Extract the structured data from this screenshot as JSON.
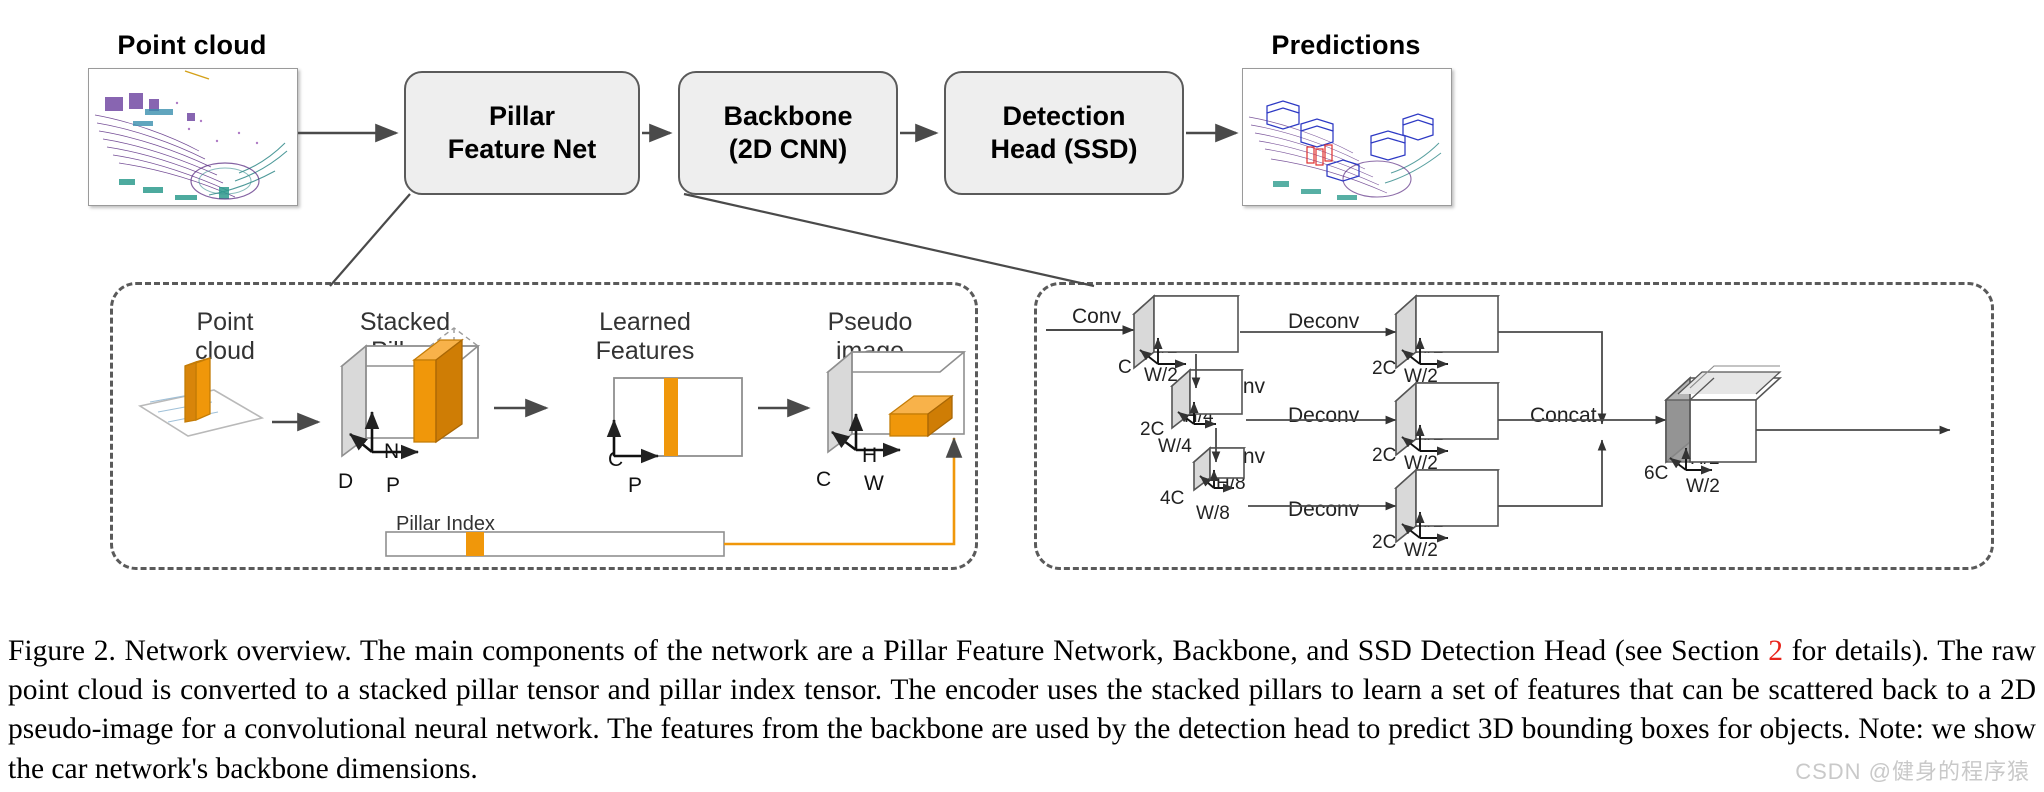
{
  "figure": {
    "id": "figure-2",
    "caption_prefix": "Figure 2. Network overview. The main components of the network are a Pillar Feature Network, Backbone, and SSD Detection Head (see Section ",
    "caption_ref": "2",
    "caption_suffix": " for details).  The raw point cloud is converted to a stacked pillar tensor and pillar index tensor.  The encoder uses the stacked pillars to learn a set of features that can be scattered back to a 2D pseudo-image for a convolutional neural network. The features from the backbone are used by the detection head to predict 3D bounding boxes for objects. Note: we show the car network's backbone dimensions.",
    "watermark": "CSDN @健身的程序猿"
  },
  "pipeline": {
    "input_label": "Point cloud",
    "output_label": "Predictions",
    "stages": [
      {
        "id": "pillar-feature-net",
        "line1": "Pillar",
        "line2": "Feature Net"
      },
      {
        "id": "backbone",
        "line1": "Backbone",
        "line2": "(2D CNN)"
      },
      {
        "id": "detection-head",
        "line1": "Detection",
        "line2": "Head (SSD)"
      }
    ]
  },
  "pillar_panel": {
    "steps": [
      {
        "id": "point-cloud",
        "title": "Point\ncloud"
      },
      {
        "id": "stacked-pillars",
        "title": "Stacked\nPillars"
      },
      {
        "id": "learned-features",
        "title": "Learned\nFeatures"
      },
      {
        "id": "pseudo-image",
        "title": "Pseudo\nimage"
      }
    ],
    "stacked_pillars_axes": {
      "vertical": "N",
      "depth": "D",
      "horizontal": "P"
    },
    "learned_features_axes": {
      "vertical": "C",
      "horizontal": "P"
    },
    "pseudo_image_axes": {
      "vertical": "H",
      "depth": "C",
      "horizontal": "W"
    },
    "pillar_index_label": "Pillar Index"
  },
  "backbone_panel": {
    "ops": {
      "conv": "Conv",
      "deconv": "Deconv",
      "concat": "Concat"
    },
    "top_down_blocks": [
      {
        "id": "block-c",
        "channels": "C",
        "height": "H/2",
        "width": "W/2"
      },
      {
        "id": "block-2c",
        "channels": "2C",
        "height": "H/4",
        "width": "W/4"
      },
      {
        "id": "block-4c",
        "channels": "4C",
        "height": "H/8",
        "width": "W/8"
      }
    ],
    "upsampled_blocks": [
      {
        "id": "up-1",
        "channels": "2C",
        "height": "H/2",
        "width": "W/2"
      },
      {
        "id": "up-2",
        "channels": "2C",
        "height": "H/2",
        "width": "W/2"
      },
      {
        "id": "up-3",
        "channels": "2C",
        "height": "H/2",
        "width": "W/2"
      }
    ],
    "concat_block": {
      "id": "concat-out",
      "channels": "6C",
      "height": "H/2",
      "width": "W/2"
    },
    "edge_labels": {
      "conv_in": "Conv",
      "conv_down_1": "Conv",
      "conv_down_2": "Conv",
      "deconv_1": "Deconv",
      "deconv_2": "Deconv",
      "deconv_3": "Deconv",
      "concat": "Concat"
    }
  },
  "colors": {
    "stage_fill": "#eeeeee",
    "stage_stroke": "#5a5a5a",
    "dashed_stroke": "#5a5a5a",
    "pillar_orange": "#f0970a",
    "pillar_orange_dark": "#d17d06",
    "cube_face": "#ffffff",
    "cube_side": "#d9d9d9",
    "concat_side": "#8f8f8f",
    "arrow": "#4a4a4a",
    "caption_ref": "#e8241c",
    "watermark": "#c9c9c9"
  }
}
